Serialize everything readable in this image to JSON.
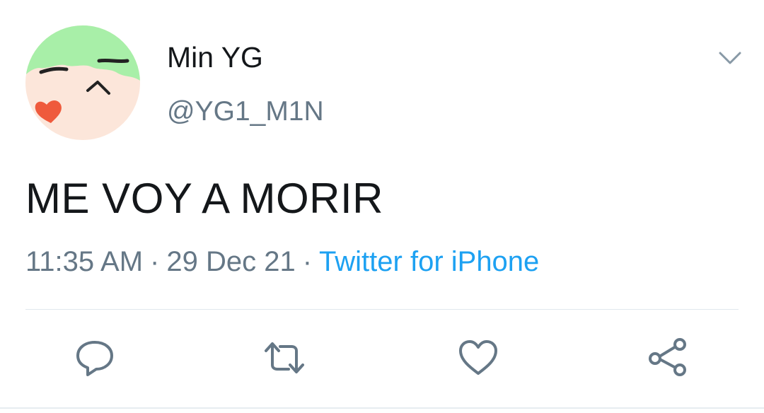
{
  "tweet": {
    "display_name": "Min YG",
    "handle": "@YG1_M1N",
    "text": "ME VOY A MORIR",
    "time": "11:35 AM",
    "date": "29 Dec 21",
    "separator": "·",
    "source": "Twitter for iPhone"
  },
  "icons": {
    "menu": "chevron-down-icon",
    "reply": "reply-icon",
    "retweet": "retweet-icon",
    "like": "heart-icon",
    "share": "share-icon"
  },
  "colors": {
    "text_primary": "#14171a",
    "text_secondary": "#657786",
    "link": "#1da1f2",
    "icon": "#657786",
    "divider": "#e1e8ed",
    "avatar_hair": "#a8efa8",
    "avatar_skin": "#fce6da",
    "avatar_heart": "#ef5a3c"
  }
}
